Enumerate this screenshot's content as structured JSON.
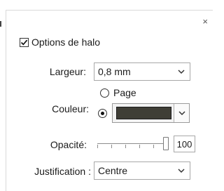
{
  "dialog": {
    "close_glyph": "×",
    "title": "Options de halo",
    "enabled": true
  },
  "largeur": {
    "label": "Largeur:",
    "value": "0,8 mm"
  },
  "couleur": {
    "label": "Couleur:",
    "option_page": "Page",
    "selected": "custom",
    "swatch_color": "#3f3e36"
  },
  "opacite": {
    "label": "Opacité:",
    "slider_fraction": 1.0,
    "value": "100"
  },
  "justification": {
    "label": "Justification :",
    "value": "Centre"
  },
  "icons": {
    "checkbox": "check-icon",
    "close": "close-icon",
    "dropdown": "chevron-down-icon"
  }
}
